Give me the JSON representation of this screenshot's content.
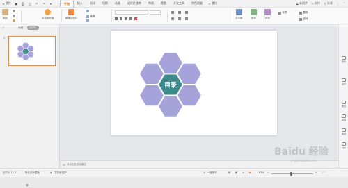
{
  "menubar": {
    "file_label": "文件",
    "tabs": [
      "开始",
      "插入",
      "设计",
      "切换",
      "动画",
      "幻灯片放映",
      "审阅",
      "视图",
      "开发工具",
      "特色功能"
    ],
    "active_tab": "开始",
    "search_label": "查找",
    "sync_label": "未同步",
    "collab_label": "协作",
    "share_label": "分享"
  },
  "ribbon": {
    "new_slide_label": "新建幻灯片",
    "paste_label": "粘贴",
    "current_label": "从当前开始",
    "reset_label": "重置",
    "textbox_label": "文本框",
    "shape_label": "形状",
    "arrange_label": "排列",
    "outline_label": "轮廓",
    "replace_label": "替换",
    "select_label": "选择"
  },
  "left_panel": {
    "tab_outline": "大纲",
    "tab_slides": "幻灯片",
    "thumbnail_number": "1",
    "add_button": "+"
  },
  "slide": {
    "title_text": "目录",
    "hex_fill": "#a5a3da",
    "center_fill": "#3d8a8c",
    "notes_placeholder": "单击此处添加备注"
  },
  "right_sidebar": {
    "items": [
      "形状",
      "设计",
      "属性",
      "动画",
      "帮助",
      "分享"
    ]
  },
  "statusbar": {
    "slide_count": "幻灯片 1 / 1",
    "theme": "默认设计模板",
    "doc_protect": "文档未保护",
    "beautify_label": "一键美化",
    "zoom": "67%"
  },
  "watermark": {
    "text": "Baidu 经验",
    "sub": "jingyan.baidu.com"
  }
}
